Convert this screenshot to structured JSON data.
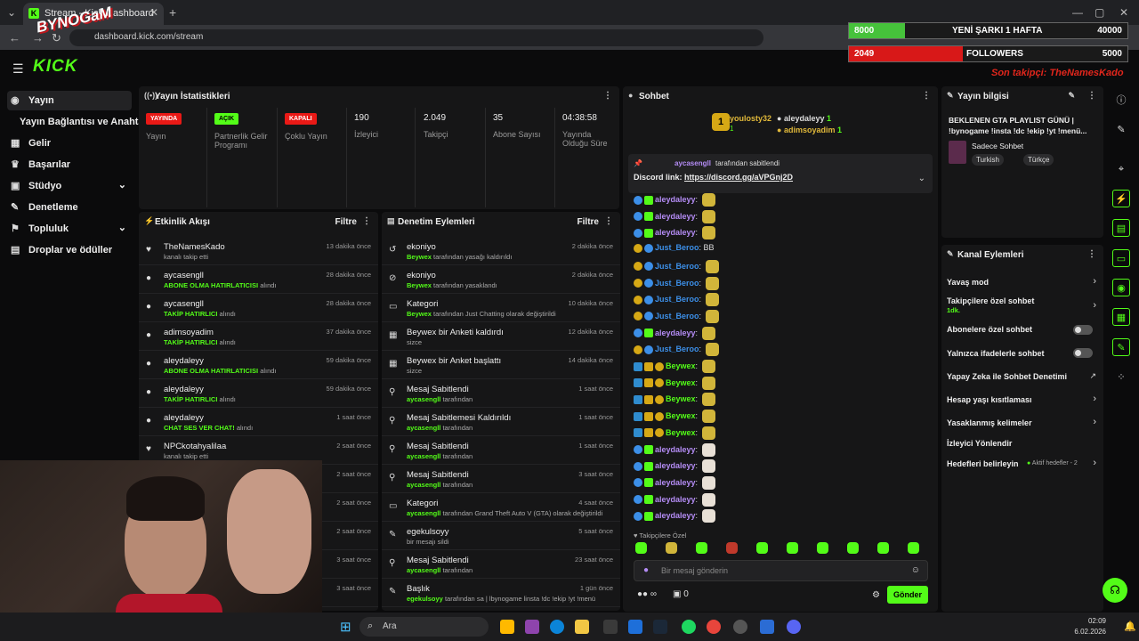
{
  "browser": {
    "tab_title": "Stream - Kick Dashboard",
    "url": "dashboard.kick.com/stream"
  },
  "app": {
    "logo": "KICK"
  },
  "sidebar": {
    "items": [
      {
        "label": "Yayın",
        "icon": "broadcast-icon"
      },
      {
        "label": "Yayın Bağlantısı ve Anahtarı",
        "icon": ""
      },
      {
        "label": "Gelir",
        "icon": "revenue-icon"
      },
      {
        "label": "Başarılar",
        "icon": "trophy-icon"
      },
      {
        "label": "Stüdyo",
        "icon": "studio-icon"
      },
      {
        "label": "Denetleme",
        "icon": "wrench-icon"
      },
      {
        "label": "Topluluk",
        "icon": "community-icon"
      },
      {
        "label": "Droplar ve ödüller",
        "icon": "gift-icon"
      }
    ]
  },
  "stats": {
    "title": "Yayın İstatistikleri",
    "items": [
      {
        "badge": "YAYINDA",
        "label": "Yayın"
      },
      {
        "badge": "AÇIK",
        "label": "Partnerlik Gelir Programı"
      },
      {
        "badge": "KAPALI",
        "label": "Çoklu Yayın"
      },
      {
        "value": "190",
        "label": "İzleyici"
      },
      {
        "value": "2.049",
        "label": "Takipçi"
      },
      {
        "value": "35",
        "label": "Abone Sayısı"
      },
      {
        "value": "04:38:58",
        "label": "Yayında Olduğu Süre"
      }
    ]
  },
  "activity": {
    "title": "Etkinlik Akışı",
    "filter": "Filtre",
    "rows": [
      {
        "user": "TheNamesKado",
        "action": "",
        "text": "kanalı takip etti",
        "time": "13 dakika önce"
      },
      {
        "user": "aycasengll",
        "action": "ABONE OLMA HATIRLATICISI",
        "text": "alındı",
        "time": "28 dakika önce"
      },
      {
        "user": "aycasengll",
        "action": "TAKİP HATIRLICI",
        "text": "alındı",
        "time": "28 dakika önce"
      },
      {
        "user": "adimsoyadim",
        "action": "TAKİP HATIRLICI",
        "text": "alındı",
        "time": "37 dakika önce"
      },
      {
        "user": "aleydaleyy",
        "action": "ABONE OLMA HATIRLATICISI",
        "text": "alındı",
        "time": "59 dakika önce"
      },
      {
        "user": "aleydaleyy",
        "action": "TAKİP HATIRLICI",
        "text": "alındı",
        "time": "59 dakika önce"
      },
      {
        "user": "aleydaleyy",
        "action": "CHAT SES VER CHAT!",
        "text": "alındı",
        "time": "1 saat önce"
      },
      {
        "user": "NPCkotahyalilaa",
        "action": "",
        "text": "kanalı takip etti",
        "time": "2 saat önce"
      },
      {
        "time": "2 saat önce"
      },
      {
        "time": "2 saat önce"
      },
      {
        "time": "2 saat önce"
      },
      {
        "time": "3 saat önce"
      },
      {
        "time": "3 saat önce"
      }
    ]
  },
  "moderation": {
    "title": "Denetim Eylemleri",
    "filter": "Filtre",
    "rows": [
      {
        "title": "ekoniyo",
        "actor": "Beywex",
        "text": "tarafından yasağı kaldırıldı",
        "time": "2 dakika önce"
      },
      {
        "title": "ekoniyo",
        "actor": "Beywex",
        "text": "tarafından yasaklandı",
        "time": "2 dakika önce"
      },
      {
        "title": "Kategori",
        "actor": "Beywex",
        "text": "tarafından Just Chatting olarak değiştirildi",
        "time": "10 dakika önce"
      },
      {
        "title": "Beywex bir Anketi kaldırdı",
        "actor": "",
        "text": "sizce",
        "time": "12 dakika önce"
      },
      {
        "title": "Beywex bir Anket başlattı",
        "actor": "",
        "text": "sizce",
        "time": "14 dakika önce"
      },
      {
        "title": "Mesaj Sabitlendi",
        "actor": "aycasengll",
        "text": "tarafından",
        "time": "1 saat önce"
      },
      {
        "title": "Mesaj Sabitlemesi Kaldırıldı",
        "actor": "aycasengll",
        "text": "tarafından",
        "time": "1 saat önce"
      },
      {
        "title": "Mesaj Sabitlendi",
        "actor": "aycasengll",
        "text": "tarafından",
        "time": "1 saat önce"
      },
      {
        "title": "Mesaj Sabitlendi",
        "actor": "aycasengll",
        "text": "tarafından",
        "time": "3 saat önce"
      },
      {
        "title": "Kategori",
        "actor": "aycasengll",
        "text": "tarafından Grand Theft Auto V (GTA) olarak değiştirildi",
        "time": "4 saat önce"
      },
      {
        "title": "egekulsoyy",
        "actor": "",
        "text": "bir mesajı sildi",
        "time": "5 saat önce"
      },
      {
        "title": "Mesaj Sabitlendi",
        "actor": "aycasengll",
        "text": "tarafından",
        "time": "23 saat önce"
      },
      {
        "title": "Başlık",
        "actor": "egekulsoyy",
        "text": "tarafından sa | lbynogame linsta !dc !ekip !yt !menü",
        "time": "1 gün önce"
      }
    ]
  },
  "chat": {
    "title": "Sohbet",
    "top": {
      "first": "youlosty32",
      "first_count": "1",
      "second": "aleydaleyy",
      "second_count": "1",
      "third": "adimsoyadim",
      "third_count": "1"
    },
    "pinned_by": "aycasengll",
    "pinned_suffix": "tarafından sabitlendi",
    "pinned_label": "Discord link:",
    "pinned_link": "https://discord.gg/aVPGnj2D",
    "messages": [
      {
        "user": "aleydaleyy",
        "text": ""
      },
      {
        "user": "aleydaleyy",
        "text": ""
      },
      {
        "user": "aleydaleyy",
        "text": ""
      },
      {
        "user": "Just_Beroo",
        "text": "BB"
      },
      {
        "user": "Just_Beroo",
        "text": ""
      },
      {
        "user": "Just_Beroo",
        "text": ""
      },
      {
        "user": "Just_Beroo",
        "text": ""
      },
      {
        "user": "Just_Beroo",
        "text": ""
      },
      {
        "user": "aleydaleyy",
        "text": ""
      },
      {
        "user": "Just_Beroo",
        "text": ""
      },
      {
        "user": "Beywex",
        "text": ""
      },
      {
        "user": "Beywex",
        "text": ""
      },
      {
        "user": "Beywex",
        "text": ""
      },
      {
        "user": "Beywex",
        "text": ""
      },
      {
        "user": "Beywex",
        "text": ""
      },
      {
        "user": "aleydaleyy",
        "text": ""
      },
      {
        "user": "aleydaleyy",
        "text": ""
      },
      {
        "user": "aleydaleyy",
        "text": ""
      },
      {
        "user": "aleydaleyy",
        "text": ""
      },
      {
        "user": "aleydaleyy",
        "text": ""
      }
    ],
    "followers_only": "Takipçilere Özel",
    "input_placeholder": "Bir mesaj gönderin",
    "points": "∞",
    "gifts": "0",
    "send": "Gönder"
  },
  "stream_info": {
    "title": "Yayın bilgisi",
    "stream_title": "BEKLENEN GTA PLAYLIST GÜNÜ | !bynogame !insta !dc !ekip !yt !menü...",
    "category": "Sadece Sohbet",
    "tags": [
      "Turkish",
      "Türkçe"
    ]
  },
  "channel_actions": {
    "title": "Kanal Eylemleri",
    "items": [
      {
        "label": "Yavaş mod"
      },
      {
        "label": "Takipçilere özel sohbet",
        "sub": "1dk."
      },
      {
        "label": "Abonelere özel sohbet"
      },
      {
        "label": "Yalnızca ifadelerle sohbet"
      },
      {
        "label": "Yapay Zeka ile Sohbet Denetimi"
      },
      {
        "label": "Hesap yaşı kısıtlaması"
      },
      {
        "label": "Yasaklanmış kelimeler"
      },
      {
        "label": "İzleyici Yönlendir"
      },
      {
        "label": "Hedefleri belirleyin",
        "sub": "Aktif hedefler - 2"
      }
    ]
  },
  "overlay": {
    "logo_text": "BYNOGaM",
    "goal1": {
      "left": "8000",
      "label": "YENİ ŞARKI 1 HAFTA",
      "right": "40000",
      "fill": 0.2
    },
    "goal2": {
      "left": "2049",
      "label": "FOLLOWERS",
      "right": "5000",
      "fill": 0.41
    },
    "last_follower": "Son takipçi: TheNamesKado"
  },
  "taskbar": {
    "search": "Ara",
    "time": "02:09",
    "date": "6.02.2026"
  },
  "colors": {
    "accent": "#53fc18",
    "live": "#e91916",
    "bg": "#0b0b0c",
    "panel": "#161617"
  }
}
